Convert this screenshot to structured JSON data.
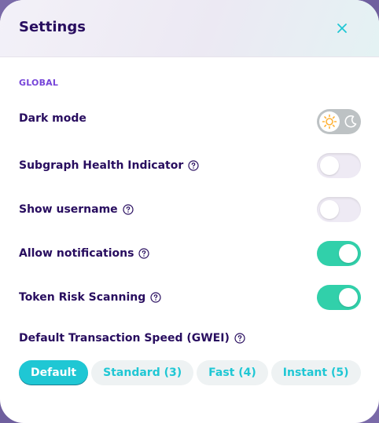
{
  "modal": {
    "title": "Settings",
    "close_icon": "close-icon"
  },
  "global_section": {
    "label": "GLOBAL",
    "dark_mode": {
      "label": "Dark mode",
      "enabled": false,
      "icons": [
        "sun-icon",
        "moon-icon"
      ]
    },
    "subgraph_health": {
      "label": "Subgraph Health Indicator",
      "enabled": false
    },
    "show_username": {
      "label": "Show username",
      "enabled": false
    },
    "allow_notifications": {
      "label": "Allow notifications",
      "enabled": true
    },
    "token_risk_scanning": {
      "label": "Token Risk Scanning",
      "enabled": true
    }
  },
  "transaction_speed": {
    "label": "Default Transaction Speed (GWEI)",
    "options": [
      "Default",
      "Standard (3)",
      "Fast (4)",
      "Instant (5)"
    ],
    "selected": "Default"
  },
  "colors": {
    "text_primary": "#280d5f",
    "accent_purple": "#7645d9",
    "toggle_on": "#31d0aa",
    "primary_teal": "#1fc7d4"
  }
}
